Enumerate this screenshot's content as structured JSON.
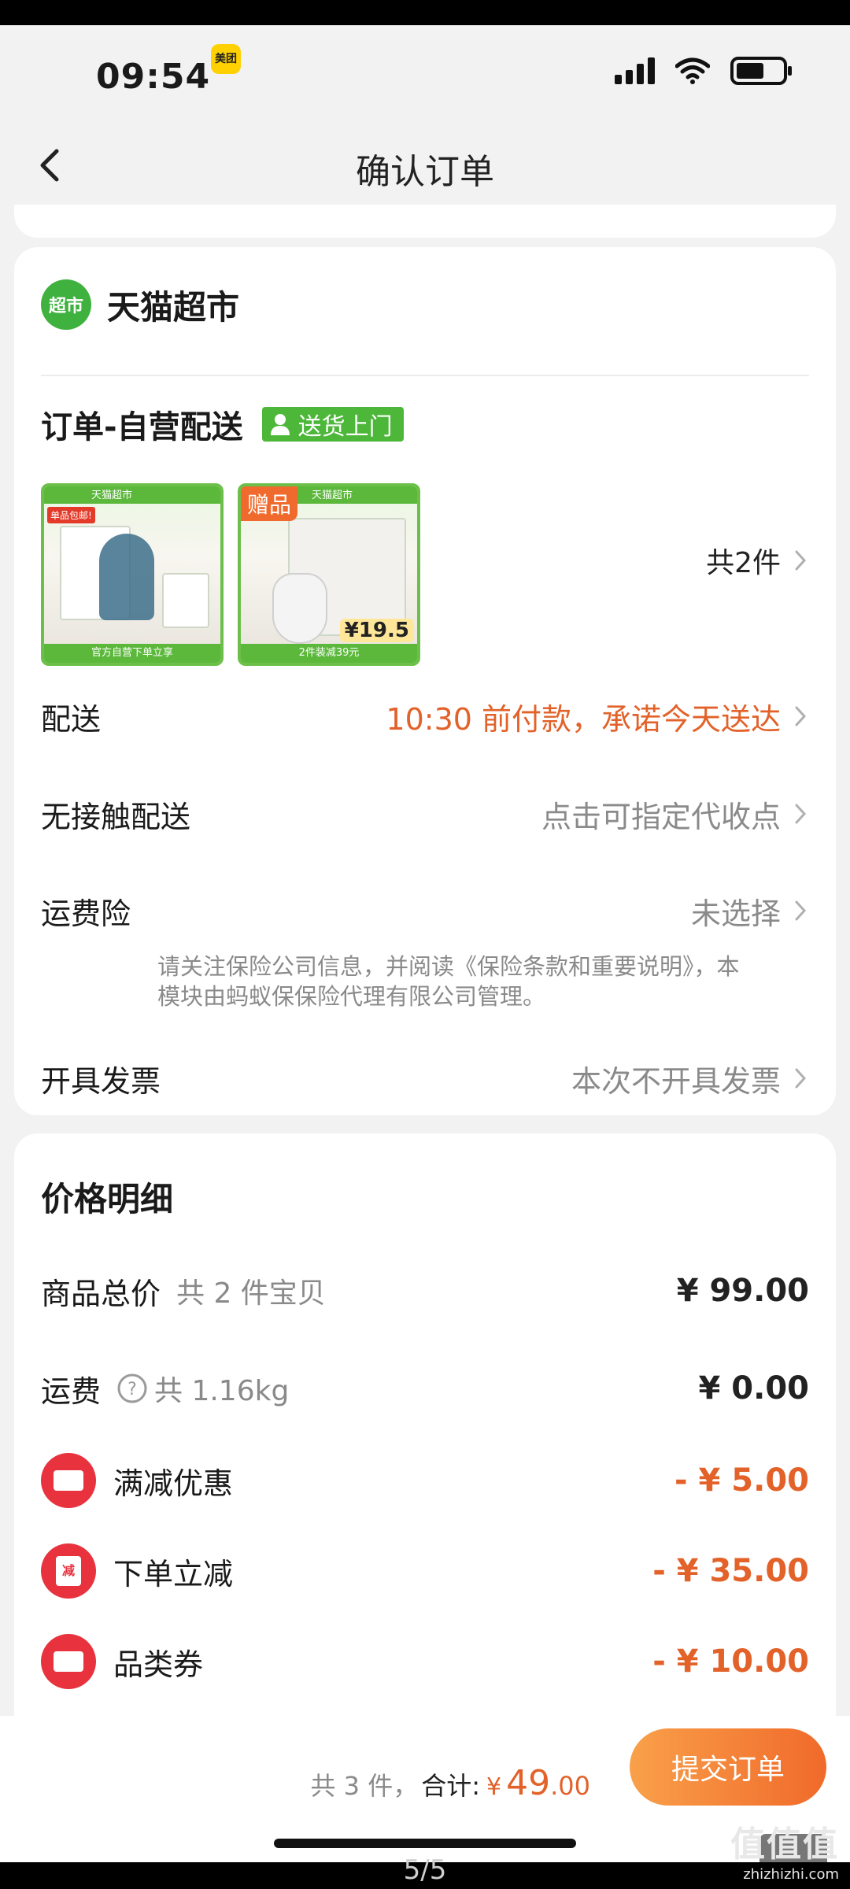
{
  "status_bar": {
    "time": "09:54",
    "meituan_badge": "美团"
  },
  "nav": {
    "title": "确认订单"
  },
  "shop": {
    "logo_text": "超市",
    "name": "天猫超市"
  },
  "delivery": {
    "title": "订单-自营配送",
    "tag": "送货上门"
  },
  "products": [
    {
      "header": "天猫超市",
      "red_tag": "单品包邮!",
      "footer": "官方自营下单立享"
    },
    {
      "gift_badge": "赠品",
      "header": "天猫超市",
      "price": "19.5",
      "footer": "2件装减39元"
    }
  ],
  "items_count": "共2件",
  "rows": {
    "shipping": {
      "label": "配送",
      "value": "10:30 前付款，承诺今天送达"
    },
    "contactless": {
      "label": "无接触配送",
      "value": "点击可指定代收点"
    },
    "insurance": {
      "label": "运费险",
      "value": "未选择",
      "note": "请关注保险公司信息，并阅读《保险条款和重要说明》，本模块由蚂蚁保保险代理有限公司管理。"
    },
    "invoice": {
      "label": "开具发票",
      "value": "本次不开具发票"
    }
  },
  "price_detail": {
    "title": "价格明细",
    "goods_total": {
      "label": "商品总价",
      "sub": "共 2 件宝贝",
      "amount": "¥ 99.00"
    },
    "freight": {
      "label": "运费",
      "sub": "共 1.16kg",
      "amount": "¥ 0.00"
    },
    "discount_full": {
      "label": "满减优惠",
      "amount": "- ¥ 5.00"
    },
    "discount_order": {
      "label": "下单立减",
      "icon_text": "减",
      "amount": "- ¥ 35.00"
    },
    "category_coupon": {
      "label": "品类券",
      "amount": "- ¥ 10.00"
    }
  },
  "bottom": {
    "count": "共 3 件，",
    "total_label": "合计:",
    "yen": "¥",
    "total_int": "49",
    "total_dec": ".00",
    "submit": "提交订单"
  },
  "page_indicator": "5/5",
  "watermark": {
    "big": "值值值",
    "small": "zhizhizhi.com"
  },
  "colors": {
    "accent_orange": "#e2622a",
    "green": "#4db73a",
    "red": "#e8333f"
  }
}
